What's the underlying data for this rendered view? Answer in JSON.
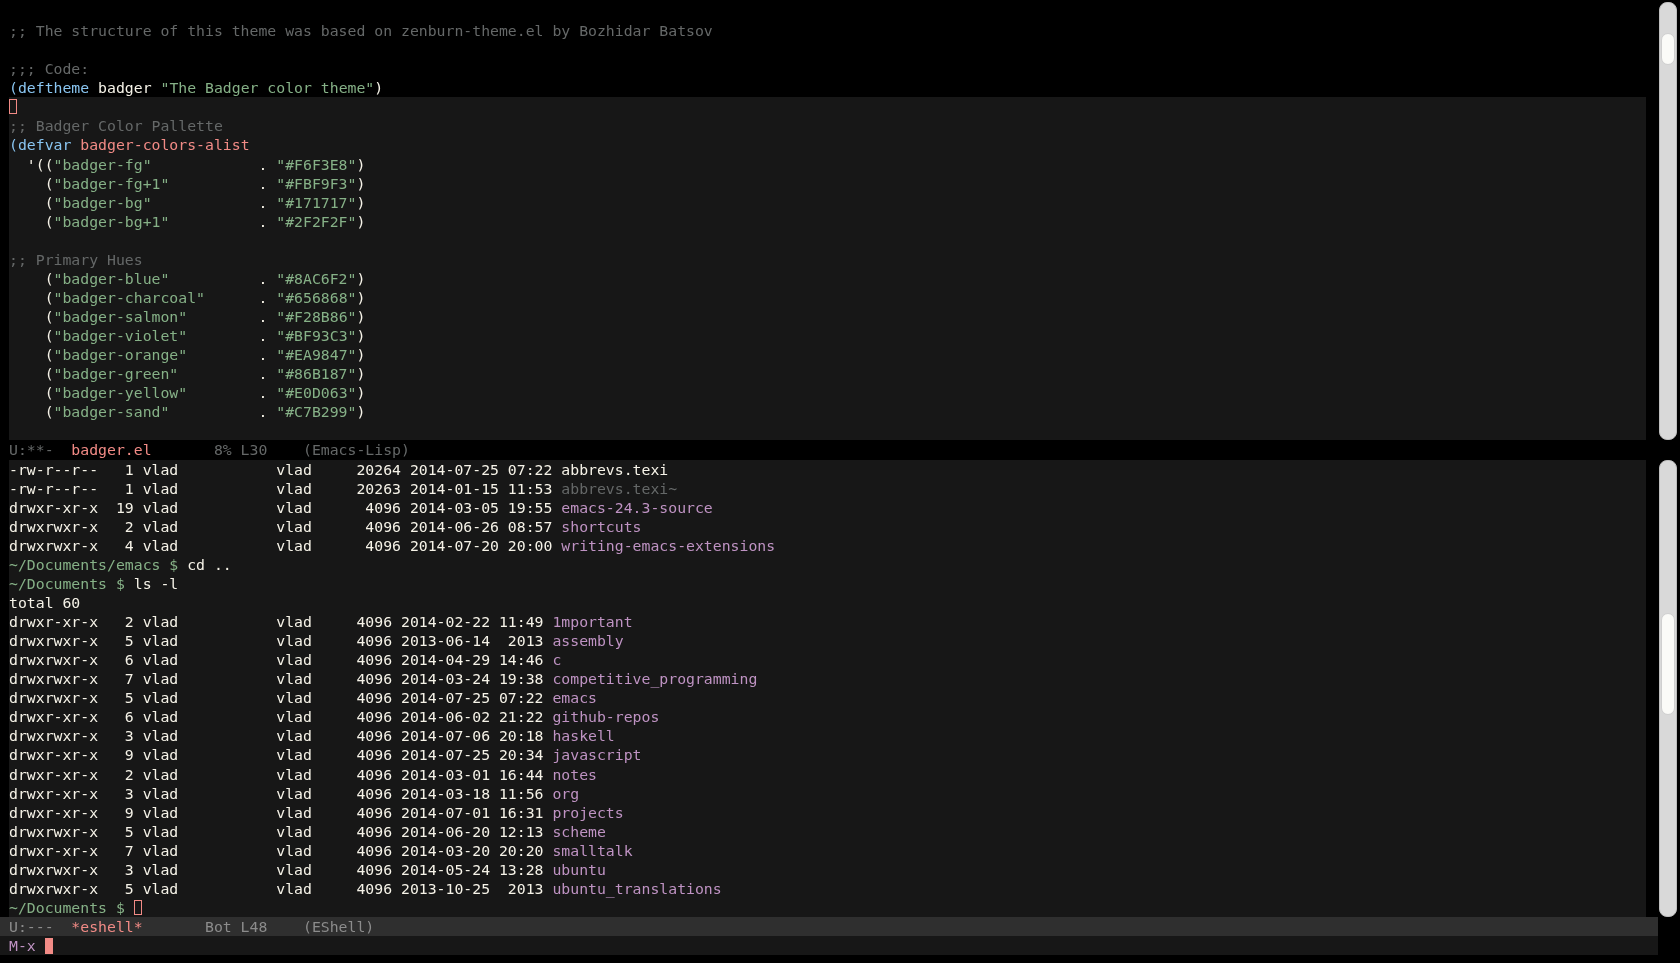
{
  "editor": {
    "header_lines": [
      {
        "cursor": false
      },
      {
        "cursor": false,
        "tokens": [
          {
            "text": ";; The structure of this theme was based on zenburn-theme.el by Bozhidar Batsov",
            "kind": "comment"
          }
        ]
      },
      {
        "cursor": false
      },
      {
        "cursor": false,
        "tokens": [
          {
            "text": ";;; Code:",
            "kind": "comment"
          }
        ]
      },
      {
        "cursor": false,
        "tokens": [
          {
            "text": "(deftheme",
            "kind": "keyword"
          },
          {
            "text": " badger ",
            "kind": "plain"
          },
          {
            "text": "\"The Badger color theme\"",
            "kind": "string"
          },
          {
            "text": ")",
            "kind": "plain"
          }
        ]
      }
    ],
    "lines": [
      {
        "cursor": true
      },
      {
        "cursor": false,
        "tokens": [
          {
            "text": ";; Badger Color Pallette",
            "kind": "comment"
          }
        ]
      },
      {
        "cursor": false,
        "tokens": [
          {
            "text": "(defvar ",
            "kind": "keyword"
          },
          {
            "text": "badger-colors-alist",
            "kind": "function"
          }
        ]
      },
      {
        "cursor": false,
        "tokens": [
          {
            "text": "  '((",
            "kind": "plain"
          },
          {
            "text": "\"badger-fg\"",
            "kind": "string"
          },
          {
            "text": "            . ",
            "kind": "plain"
          },
          {
            "text": "\"#F6F3E8\"",
            "kind": "string"
          },
          {
            "text": ")",
            "kind": "plain"
          }
        ]
      },
      {
        "cursor": false,
        "tokens": [
          {
            "text": "    (",
            "kind": "plain"
          },
          {
            "text": "\"badger-fg+1\"",
            "kind": "string"
          },
          {
            "text": "          . ",
            "kind": "plain"
          },
          {
            "text": "\"#FBF9F3\"",
            "kind": "string"
          },
          {
            "text": ")",
            "kind": "plain"
          }
        ]
      },
      {
        "cursor": false,
        "tokens": [
          {
            "text": "    (",
            "kind": "plain"
          },
          {
            "text": "\"badger-bg\"",
            "kind": "string"
          },
          {
            "text": "            . ",
            "kind": "plain"
          },
          {
            "text": "\"#171717\"",
            "kind": "string"
          },
          {
            "text": ")",
            "kind": "plain"
          }
        ]
      },
      {
        "cursor": false,
        "tokens": [
          {
            "text": "    (",
            "kind": "plain"
          },
          {
            "text": "\"badger-bg+1\"",
            "kind": "string"
          },
          {
            "text": "          . ",
            "kind": "plain"
          },
          {
            "text": "\"#2F2F2F\"",
            "kind": "string"
          },
          {
            "text": ")",
            "kind": "plain"
          }
        ]
      },
      {
        "cursor": false
      },
      {
        "cursor": false,
        "tokens": [
          {
            "text": ";; Primary Hues",
            "kind": "comment"
          }
        ]
      },
      {
        "cursor": false,
        "tokens": [
          {
            "text": "    (",
            "kind": "plain"
          },
          {
            "text": "\"badger-blue\"",
            "kind": "string"
          },
          {
            "text": "          . ",
            "kind": "plain"
          },
          {
            "text": "\"#8AC6F2\"",
            "kind": "string"
          },
          {
            "text": ")",
            "kind": "plain"
          }
        ]
      },
      {
        "cursor": false,
        "tokens": [
          {
            "text": "    (",
            "kind": "plain"
          },
          {
            "text": "\"badger-charcoal\"",
            "kind": "string"
          },
          {
            "text": "      . ",
            "kind": "plain"
          },
          {
            "text": "\"#656868\"",
            "kind": "string"
          },
          {
            "text": ")",
            "kind": "plain"
          }
        ]
      },
      {
        "cursor": false,
        "tokens": [
          {
            "text": "    (",
            "kind": "plain"
          },
          {
            "text": "\"badger-salmon\"",
            "kind": "string"
          },
          {
            "text": "        . ",
            "kind": "plain"
          },
          {
            "text": "\"#F28B86\"",
            "kind": "string"
          },
          {
            "text": ")",
            "kind": "plain"
          }
        ]
      },
      {
        "cursor": false,
        "tokens": [
          {
            "text": "    (",
            "kind": "plain"
          },
          {
            "text": "\"badger-violet\"",
            "kind": "string"
          },
          {
            "text": "        . ",
            "kind": "plain"
          },
          {
            "text": "\"#BF93C3\"",
            "kind": "string"
          },
          {
            "text": ")",
            "kind": "plain"
          }
        ]
      },
      {
        "cursor": false,
        "tokens": [
          {
            "text": "    (",
            "kind": "plain"
          },
          {
            "text": "\"badger-orange\"",
            "kind": "string"
          },
          {
            "text": "        . ",
            "kind": "plain"
          },
          {
            "text": "\"#EA9847\"",
            "kind": "string"
          },
          {
            "text": ")",
            "kind": "plain"
          }
        ]
      },
      {
        "cursor": false,
        "tokens": [
          {
            "text": "    (",
            "kind": "plain"
          },
          {
            "text": "\"badger-green\"",
            "kind": "string"
          },
          {
            "text": "         . ",
            "kind": "plain"
          },
          {
            "text": "\"#86B187\"",
            "kind": "string"
          },
          {
            "text": ")",
            "kind": "plain"
          }
        ]
      },
      {
        "cursor": false,
        "tokens": [
          {
            "text": "    (",
            "kind": "plain"
          },
          {
            "text": "\"badger-yellow\"",
            "kind": "string"
          },
          {
            "text": "        . ",
            "kind": "plain"
          },
          {
            "text": "\"#E0D063\"",
            "kind": "string"
          },
          {
            "text": ")",
            "kind": "plain"
          }
        ]
      },
      {
        "cursor": false,
        "tokens": [
          {
            "text": "    (",
            "kind": "plain"
          },
          {
            "text": "\"badger-sand\"",
            "kind": "string"
          },
          {
            "text": "          . ",
            "kind": "plain"
          },
          {
            "text": "\"#C7B299\"",
            "kind": "string"
          },
          {
            "text": ")",
            "kind": "plain"
          }
        ]
      },
      {
        "cursor": false
      }
    ],
    "mode_line": {
      "active": false,
      "status": "U:**-",
      "buffer": "badger.el",
      "position": "8% L30",
      "mode": "(Emacs-Lisp)"
    }
  },
  "shell": {
    "lines": [
      {
        "kind": "entry",
        "info": "-rw-r--r--   1 vlad           vlad     20264 2014-07-25 07:22",
        "name": "abbrevs.texi",
        "color": "#f6f3e8"
      },
      {
        "kind": "entry",
        "info": "-rw-r--r--   1 vlad           vlad     20263 2014-01-15 11:53",
        "name": "abbrevs.texi~",
        "color": "#656868"
      },
      {
        "kind": "entry",
        "info": "drwxr-xr-x  19 vlad           vlad      4096 2014-03-05 19:55",
        "name": "emacs-24.3-source",
        "color": "#bf93c3"
      },
      {
        "kind": "entry",
        "info": "drwxrwxr-x   2 vlad           vlad      4096 2014-06-26 08:57",
        "name": "shortcuts",
        "color": "#bf93c3"
      },
      {
        "kind": "entry",
        "info": "drwxrwxr-x   4 vlad           vlad      4096 2014-07-20 20:00",
        "name": "writing-emacs-extensions",
        "color": "#bf93c3"
      },
      {
        "kind": "prompt",
        "prompt": "~/Documents/emacs $",
        "command": "cd ..",
        "cursor": false
      },
      {
        "kind": "prompt",
        "prompt": "~/Documents $",
        "command": "ls -l",
        "cursor": false
      },
      {
        "kind": "output",
        "text": "total 60"
      },
      {
        "kind": "entry",
        "info": "drwxr-xr-x   2 vlad           vlad     4096 2014-02-22 11:49",
        "name": "1mportant",
        "color": "#bf93c3"
      },
      {
        "kind": "entry",
        "info": "drwxrwxr-x   5 vlad           vlad     4096 2013-06-14  2013",
        "name": "assembly",
        "color": "#bf93c3"
      },
      {
        "kind": "entry",
        "info": "drwxrwxr-x   6 vlad           vlad     4096 2014-04-29 14:46",
        "name": "c",
        "color": "#bf93c3"
      },
      {
        "kind": "entry",
        "info": "drwxrwxr-x   7 vlad           vlad     4096 2014-03-24 19:38",
        "name": "competitive_programming",
        "color": "#bf93c3"
      },
      {
        "kind": "entry",
        "info": "drwxrwxr-x   5 vlad           vlad     4096 2014-07-25 07:22",
        "name": "emacs",
        "color": "#bf93c3"
      },
      {
        "kind": "entry",
        "info": "drwxr-xr-x   6 vlad           vlad     4096 2014-06-02 21:22",
        "name": "github-repos",
        "color": "#bf93c3"
      },
      {
        "kind": "entry",
        "info": "drwxrwxr-x   3 vlad           vlad     4096 2014-07-06 20:18",
        "name": "haskell",
        "color": "#bf93c3"
      },
      {
        "kind": "entry",
        "info": "drwxr-xr-x   9 vlad           vlad     4096 2014-07-25 20:34",
        "name": "javascript",
        "color": "#bf93c3"
      },
      {
        "kind": "entry",
        "info": "drwxr-xr-x   2 vlad           vlad     4096 2014-03-01 16:44",
        "name": "notes",
        "color": "#bf93c3"
      },
      {
        "kind": "entry",
        "info": "drwxr-xr-x   3 vlad           vlad     4096 2014-03-18 11:56",
        "name": "org",
        "color": "#bf93c3"
      },
      {
        "kind": "entry",
        "info": "drwxr-xr-x   9 vlad           vlad     4096 2014-07-01 16:31",
        "name": "projects",
        "color": "#bf93c3"
      },
      {
        "kind": "entry",
        "info": "drwxrwxr-x   5 vlad           vlad     4096 2014-06-20 12:13",
        "name": "scheme",
        "color": "#bf93c3"
      },
      {
        "kind": "entry",
        "info": "drwxr-xr-x   7 vlad           vlad     4096 2014-03-20 20:20",
        "name": "smalltalk",
        "color": "#bf93c3"
      },
      {
        "kind": "entry",
        "info": "drwxrwxr-x   3 vlad           vlad     4096 2014-05-24 13:28",
        "name": "ubuntu",
        "color": "#bf93c3"
      },
      {
        "kind": "entry",
        "info": "drwxrwxr-x   5 vlad           vlad     4096 2013-10-25  2013",
        "name": "ubuntu_translations",
        "color": "#bf93c3"
      },
      {
        "kind": "prompt",
        "prompt": "~/Documents $",
        "cursor": true
      }
    ],
    "mode_line": {
      "active": true,
      "status": "U:---",
      "buffer": "*eshell*",
      "position": "Bot L48",
      "mode": "(EShell)"
    }
  },
  "minibuffer": {
    "prompt": "M-x",
    "cursor": true
  }
}
